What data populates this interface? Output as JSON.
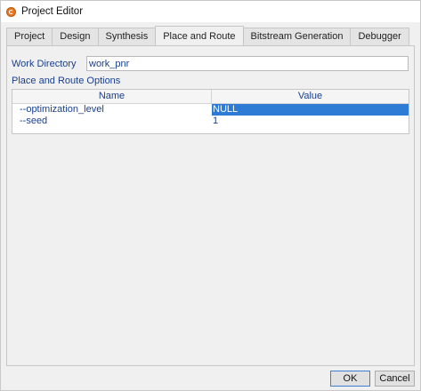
{
  "window": {
    "title": "Project Editor",
    "icon": "app-logo-icon"
  },
  "tabs": [
    {
      "label": "Project",
      "active": false
    },
    {
      "label": "Design",
      "active": false
    },
    {
      "label": "Synthesis",
      "active": false
    },
    {
      "label": "Place and Route",
      "active": true
    },
    {
      "label": "Bitstream Generation",
      "active": false
    },
    {
      "label": "Debugger",
      "active": false
    }
  ],
  "work_directory": {
    "label": "Work Directory",
    "value": "work_pnr"
  },
  "options": {
    "section_label": "Place and Route Options",
    "columns": {
      "name": "Name",
      "value": "Value"
    },
    "rows": [
      {
        "name": "--optimization_level",
        "value": "NULL",
        "selected": true
      },
      {
        "name": "--seed",
        "value": "1",
        "selected": false
      }
    ]
  },
  "buttons": {
    "ok": "OK",
    "cancel": "Cancel"
  },
  "colors": {
    "selection": "#2e7bd6",
    "label_text": "#1a3f8a"
  }
}
